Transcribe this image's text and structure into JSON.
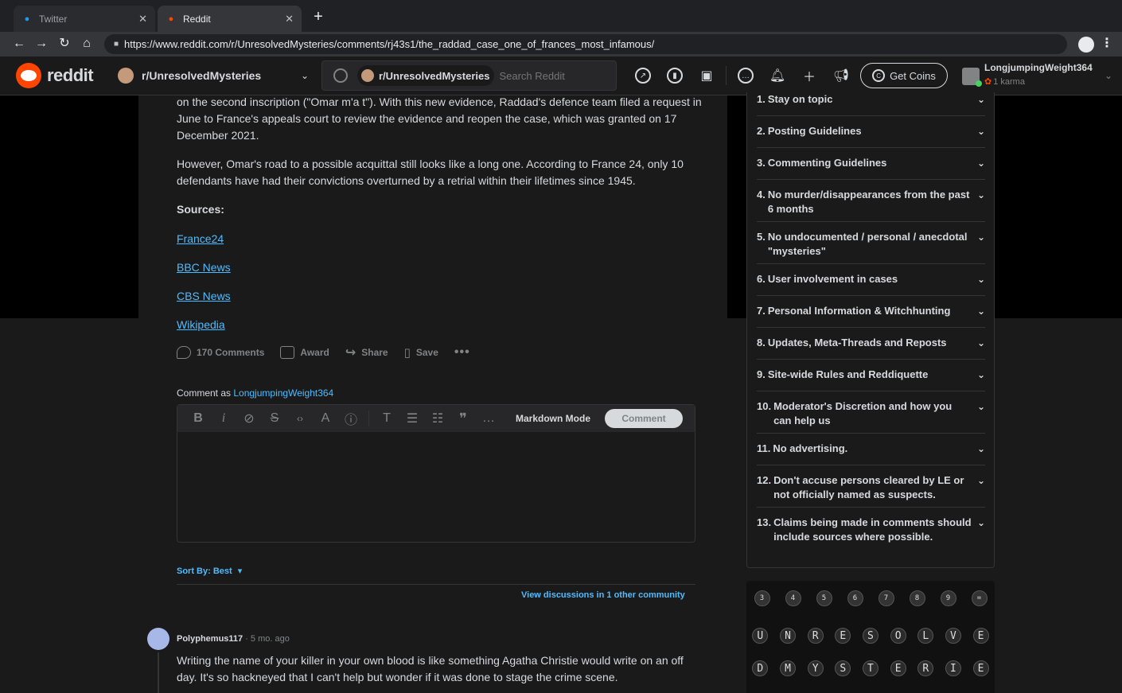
{
  "browser": {
    "tabs": [
      {
        "title": "Twitter",
        "icon": "twitter-bird-icon"
      },
      {
        "title": "Reddit",
        "icon": "reddit-alien-icon"
      }
    ],
    "url": "https://www.reddit.com/r/UnresolvedMysteries/comments/rj43s1/the_raddad_case_one_of_frances_most_infamous/"
  },
  "header": {
    "wordmark": "reddit",
    "community": "r/UnresolvedMysteries",
    "search_chip": "r/UnresolvedMysteries",
    "search_placeholder": "Search Reddit",
    "get_coins": "Get Coins",
    "username": "LongjumpingWeight364",
    "karma": "1 karma"
  },
  "post": {
    "paragraphs": [
      "on the second inscription (\"Omar m'a t\"). With this new evidence, Raddad's defence team filed a request in June to France's appeals court to review the evidence and reopen the case, which was granted on 17 December 2021.",
      "However, Omar's road to a possible acquittal still looks like a long one. According to France 24, only 10 defendants have had their convictions overturned by a retrial within their lifetimes since 1945."
    ],
    "sources_heading": "Sources:",
    "sources": [
      "France24",
      "BBC News",
      "CBS News",
      "Wikipedia"
    ],
    "actions": {
      "comments": "170 Comments",
      "award": "Award",
      "share": "Share",
      "save": "Save"
    }
  },
  "composer": {
    "comment_as_prefix": "Comment as ",
    "comment_as_user": "LongjumpingWeight364",
    "markdown_mode": "Markdown Mode",
    "comment_button": "Comment",
    "toolbar_icons": [
      "bold-icon",
      "italic-icon",
      "link-icon",
      "strikethrough-icon",
      "inline-code-icon",
      "superscript-icon",
      "spoiler-icon",
      "heading-icon",
      "bulleted-list-icon",
      "numbered-list-icon",
      "quote-block-icon",
      "more-icon"
    ]
  },
  "sort": {
    "label": "Sort By: Best",
    "view_discussions": "View discussions in 1 other community"
  },
  "comment": {
    "author": "Polyphemus117",
    "time": " · 5 mo. ago",
    "body": "Writing the name of your killer in your own blood is like something Agatha Christie would write on an off day. It's so hackneyed that I can't help but wonder if it was done to stage the crime scene."
  },
  "rules": [
    {
      "num": "1.",
      "text": "Stay on topic"
    },
    {
      "num": "2.",
      "text": "Posting Guidelines"
    },
    {
      "num": "3.",
      "text": "Commenting Guidelines"
    },
    {
      "num": "4.",
      "text": "No murder/disappearances from the past 6 months"
    },
    {
      "num": "5.",
      "text": "No undocumented / personal / anecdotal \"mysteries\""
    },
    {
      "num": "6.",
      "text": "User involvement in cases"
    },
    {
      "num": "7.",
      "text": "Personal Information & Witchhunting"
    },
    {
      "num": "8.",
      "text": "Updates, Meta-Threads and Reposts"
    },
    {
      "num": "9.",
      "text": "Site-wide Rules and Reddiquette"
    },
    {
      "num": "10.",
      "text": "Moderator's Discretion and how you can help us"
    },
    {
      "num": "11.",
      "text": "No advertising."
    },
    {
      "num": "12.",
      "text": "Don't accuse persons cleared by LE or not officially named as suspects."
    },
    {
      "num": "13.",
      "text": "Claims being made in comments should include sources where possible."
    }
  ],
  "banner_keys": {
    "top_row": [
      "3",
      "4",
      "5",
      "6",
      "7",
      "8",
      "9",
      "="
    ],
    "row1": [
      "U",
      "N",
      "R",
      "E",
      "S",
      "O",
      "L",
      "V",
      "E"
    ],
    "row2": [
      "D",
      "M",
      "Y",
      "S",
      "T",
      "E",
      "R",
      "I",
      "E"
    ]
  }
}
